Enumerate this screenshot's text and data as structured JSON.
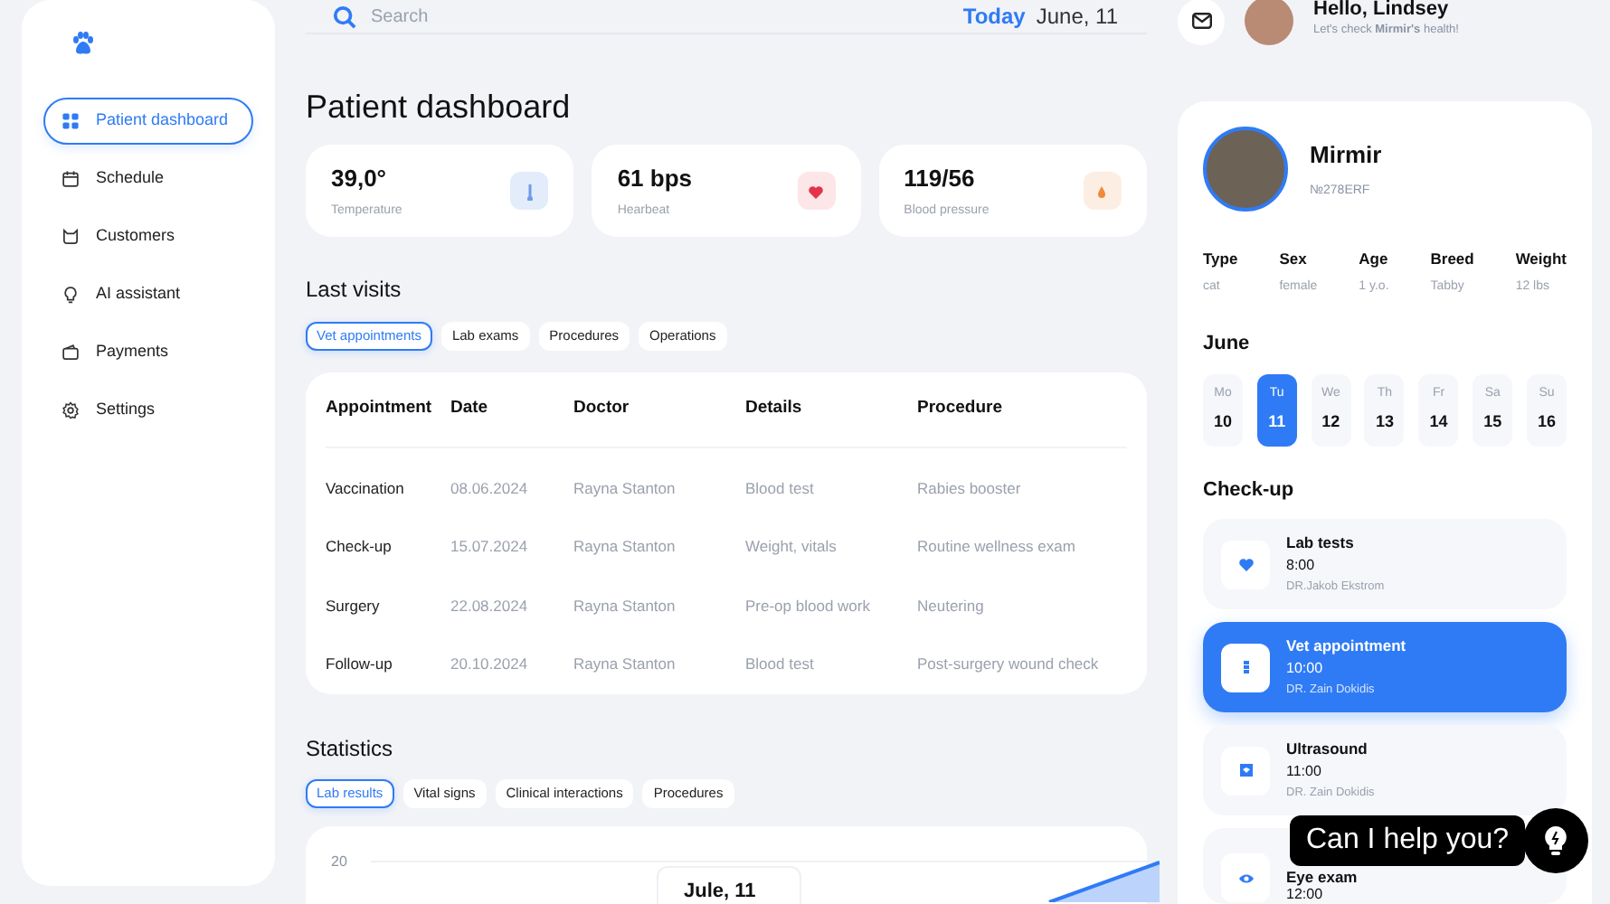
{
  "sidebar": {
    "items": [
      {
        "label": "Patient dashboard",
        "kind": "grid",
        "selected": true
      },
      {
        "label": "Schedule",
        "kind": "calendar",
        "selected": false
      },
      {
        "label": "Customers",
        "kind": "cat",
        "selected": false
      },
      {
        "label": "AI assistant",
        "kind": "bulb",
        "selected": false
      },
      {
        "label": "Payments",
        "kind": "wallet",
        "selected": false
      },
      {
        "label": "Settings",
        "kind": "gear",
        "selected": false
      }
    ]
  },
  "search": {
    "placeholder": "Search"
  },
  "today": {
    "label": "Today",
    "date": "June, 11"
  },
  "user": {
    "greeting": "Hello, Lindsey",
    "subtitle": "Let's check **Mirmir's** health!"
  },
  "page_title": "Patient dashboard",
  "stats": [
    {
      "value": "39,0°",
      "label": "Temperature",
      "kind": "temperature"
    },
    {
      "value": "61 bps",
      "label": "Hearbeat",
      "kind": "heart"
    },
    {
      "value": "119/56",
      "label": "Blood pressure",
      "kind": "drop"
    }
  ],
  "last_visits": {
    "title": "Last visits",
    "tabs": [
      {
        "label": "Vet appointments",
        "selected": true
      },
      {
        "label": "Lab exams",
        "selected": false
      },
      {
        "label": "Procedures",
        "selected": false
      },
      {
        "label": "Operations",
        "selected": false
      }
    ],
    "table": {
      "columns": [
        "Appointment",
        "Date",
        "Doctor",
        "Details",
        "Procedure"
      ],
      "rows": [
        [
          "Vaccination",
          "08.06.2024",
          "Rayna Stanton",
          "Blood test",
          "Rabies booster"
        ],
        [
          "Check-up",
          "15.07.2024",
          "Rayna Stanton",
          "Weight, vitals",
          "Routine wellness exam"
        ],
        [
          "Surgery",
          "22.08.2024",
          "Rayna Stanton",
          "Pre-op blood work",
          "Neutering"
        ],
        [
          "Follow-up",
          "20.10.2024",
          "Rayna Stanton",
          "Blood test",
          "Post-surgery wound check"
        ]
      ]
    }
  },
  "statistics": {
    "title": "Statistics",
    "tabs": [
      {
        "label": "Lab results",
        "selected": true
      },
      {
        "label": "Vital signs",
        "selected": false
      },
      {
        "label": "Clinical interactions",
        "selected": false
      },
      {
        "label": "Procedures",
        "selected": false
      }
    ],
    "chart": {
      "tick": "20",
      "tooltip": "Jule, 11"
    }
  },
  "patient": {
    "name": "Mirmir",
    "id": "№278ERF",
    "attributes": [
      {
        "label": "Type",
        "value": "cat"
      },
      {
        "label": "Sex",
        "value": "female"
      },
      {
        "label": "Age",
        "value": "1 y.o."
      },
      {
        "label": "Breed",
        "value": "Tabby"
      },
      {
        "label": "Weight",
        "value": "12 lbs"
      }
    ],
    "month": "June",
    "days": [
      {
        "weekday": "Mo",
        "day": "10",
        "selected": false
      },
      {
        "weekday": "Tu",
        "day": "11",
        "selected": true
      },
      {
        "weekday": "We",
        "day": "12",
        "selected": false
      },
      {
        "weekday": "Th",
        "day": "13",
        "selected": false
      },
      {
        "weekday": "Fr",
        "day": "14",
        "selected": false
      },
      {
        "weekday": "Sa",
        "day": "15",
        "selected": false
      },
      {
        "weekday": "Su",
        "day": "16",
        "selected": false
      }
    ],
    "checkup_title": "Check-up",
    "appointments": [
      {
        "title": "Lab tests",
        "time": "8:00",
        "doctor": "DR.Jakob Ekstrom",
        "kind": "heart",
        "selected": false
      },
      {
        "title": "Vet appointment",
        "time": "10:00",
        "doctor": "DR. Zain Dokidis",
        "kind": "list",
        "selected": true
      },
      {
        "title": "Ultrasound",
        "time": "11:00",
        "doctor": "DR. Zain Dokidis",
        "kind": "screen",
        "selected": false
      },
      {
        "title": "Eye exam",
        "time": "12:00",
        "kind": "eye",
        "selected": false
      }
    ]
  },
  "assistant": {
    "text": "Can I help you?"
  }
}
